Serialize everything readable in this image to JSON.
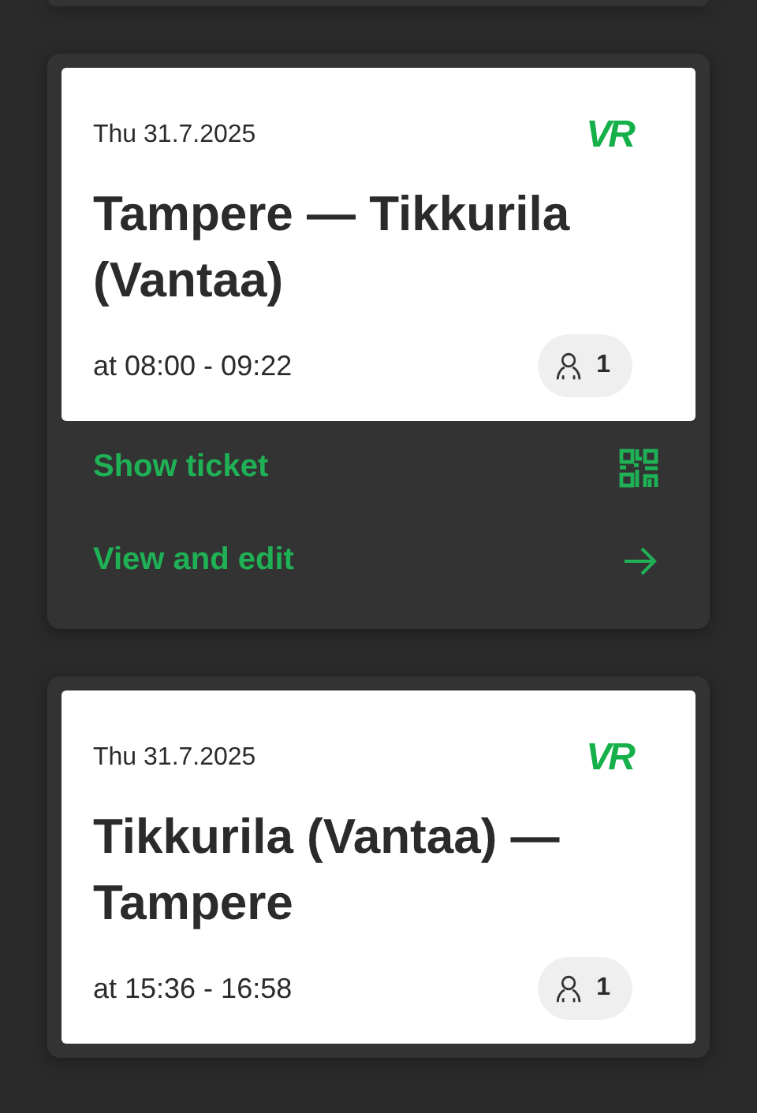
{
  "trips": [
    {
      "date": "Thu 31.7.2025",
      "logo": "VR",
      "route": "Tampere — Tikkurila (Vantaa)",
      "time": "at 08:00 - 09:22",
      "passengers": "1",
      "actions": [
        {
          "label": "Show ticket",
          "kind": "qr"
        },
        {
          "label": "View and edit",
          "kind": "arrow"
        }
      ]
    },
    {
      "date": "Thu 31.7.2025",
      "logo": "VR",
      "route": "Tikkurila (Vantaa) — Tampere",
      "time": "at 15:36 - 16:58",
      "passengers": "1"
    }
  ]
}
